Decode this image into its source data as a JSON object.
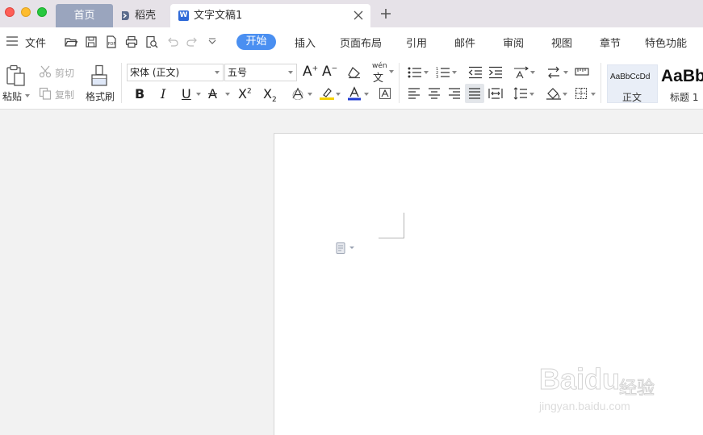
{
  "titlebar": {
    "tabs": [
      {
        "label": "首页"
      },
      {
        "label": "稻壳"
      },
      {
        "label": "文字文稿1",
        "icon": "W"
      }
    ]
  },
  "menubar": {
    "file": "文件",
    "items": [
      "开始",
      "插入",
      "页面布局",
      "引用",
      "邮件",
      "审阅",
      "视图",
      "章节",
      "特色功能"
    ]
  },
  "ribbon": {
    "paste": "粘贴",
    "cut": "剪切",
    "copy": "复制",
    "format_painter": "格式刷",
    "font_name": "宋体 (正文)",
    "font_size": "五号",
    "bold": "B",
    "italic": "I",
    "underline": "U",
    "strike": "A",
    "superscript_base": "X",
    "superscript_mark": "2",
    "subscript_base": "X",
    "subscript_mark": "2",
    "grow_font": "A",
    "shrink_font": "A",
    "pinyin": "wén",
    "styles": [
      {
        "preview": "AaBbCcDd",
        "name": "正文"
      },
      {
        "preview": "AaBb",
        "name": "标题 1"
      }
    ]
  },
  "watermark": {
    "brand": "Bai",
    "brand2": "du",
    "cn": "经验",
    "url": "jingyan.baidu.com"
  },
  "colors": {
    "accent": "#4a8ff1",
    "tab_home": "#9aa5be",
    "highlight": "#f5d100",
    "font_color": "#1f3bd1"
  }
}
